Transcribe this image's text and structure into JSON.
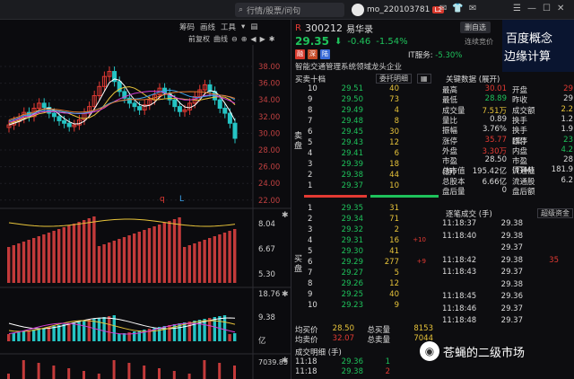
{
  "top": {
    "search_placeholder": "行情/股票/问句",
    "username": "mo_220103781",
    "level_badge": "L2"
  },
  "chart_toolbar": {
    "items": [
      "筹码",
      "画线",
      "工具"
    ],
    "items2": [
      "前复权",
      "曲线"
    ]
  },
  "chart": {
    "price_axis": [
      "38.00",
      "36.00",
      "34.00",
      "32.00",
      "30.00",
      "28.00",
      "26.00",
      "24.00",
      "22.00"
    ],
    "vol_axis": [
      "8.04",
      "6.67",
      "5.30"
    ],
    "macd_axis": [
      "18.76",
      "9.38",
      "亿"
    ],
    "bottom_axis": [
      "7039.85"
    ],
    "markers": [
      "q",
      "L"
    ]
  },
  "stock": {
    "prefix": "R",
    "code": "300212",
    "name": "易华录",
    "price": "29.35",
    "change": "-0.46",
    "change_pct": "-1.54%",
    "btn_delete": "删自选",
    "btn_auction": "连续竞价",
    "it_service_label": "IT服务:",
    "it_service_pct": "-5.30%",
    "tagline": "智能交通管理系统领域龙头企业",
    "flags": [
      "融",
      "深",
      "陆"
    ],
    "promo": [
      "百度概念",
      "边缘计算"
    ]
  },
  "orderbook": {
    "sell_title": "买卖十档",
    "delegate_btn": "委托明细",
    "sell_label": "卖盘",
    "buy_label": "买盘",
    "sells": [
      {
        "lvl": "10",
        "price": "29.51",
        "vol": "40",
        "extra": ""
      },
      {
        "lvl": "9",
        "price": "29.50",
        "vol": "73",
        "extra": ""
      },
      {
        "lvl": "8",
        "price": "29.49",
        "vol": "4",
        "extra": ""
      },
      {
        "lvl": "7",
        "price": "29.48",
        "vol": "8",
        "extra": ""
      },
      {
        "lvl": "6",
        "price": "29.45",
        "vol": "30",
        "extra": ""
      },
      {
        "lvl": "5",
        "price": "29.43",
        "vol": "12",
        "extra": ""
      },
      {
        "lvl": "4",
        "price": "29.41",
        "vol": "6",
        "extra": ""
      },
      {
        "lvl": "3",
        "price": "29.39",
        "vol": "18",
        "extra": ""
      },
      {
        "lvl": "2",
        "price": "29.38",
        "vol": "44",
        "extra": ""
      },
      {
        "lvl": "1",
        "price": "29.37",
        "vol": "10",
        "extra": ""
      }
    ],
    "buys": [
      {
        "lvl": "1",
        "price": "29.35",
        "vol": "31",
        "extra": ""
      },
      {
        "lvl": "2",
        "price": "29.34",
        "vol": "71",
        "extra": ""
      },
      {
        "lvl": "3",
        "price": "29.32",
        "vol": "2",
        "extra": ""
      },
      {
        "lvl": "4",
        "price": "29.31",
        "vol": "16",
        "extra": "+10"
      },
      {
        "lvl": "5",
        "price": "29.30",
        "vol": "41",
        "extra": ""
      },
      {
        "lvl": "6",
        "price": "29.29",
        "vol": "277",
        "extra": "+9"
      },
      {
        "lvl": "7",
        "price": "29.27",
        "vol": "5",
        "extra": ""
      },
      {
        "lvl": "8",
        "price": "29.26",
        "vol": "12",
        "extra": ""
      },
      {
        "lvl": "9",
        "price": "29.25",
        "vol": "40",
        "extra": ""
      },
      {
        "lvl": "10",
        "price": "29.23",
        "vol": "9",
        "extra": ""
      }
    ],
    "avg_buy_label": "均买价",
    "avg_buy": "28.50",
    "total_buy_label": "总买量",
    "total_buy": "8153",
    "avg_sell_label": "均卖价",
    "avg_sell": "32.07",
    "total_sell_label": "总卖量",
    "total_sell": "7044"
  },
  "stats": {
    "title": "关键数据 (展开)",
    "rows": [
      {
        "k": "最高",
        "v": "30.01",
        "vc": "red",
        "k2": "开盘",
        "v2": "29",
        "v2c": "red"
      },
      {
        "k": "最低",
        "v": "28.89",
        "vc": "green",
        "k2": "昨收",
        "v2": "29",
        "v2c": "white"
      },
      {
        "k": "成交量",
        "v": "7.51万",
        "vc": "yellow",
        "k2": "成交额",
        "v2": "2.2",
        "v2c": "yellow"
      },
      {
        "k": "量比",
        "v": "0.89",
        "vc": "white",
        "k2": "换手",
        "v2": "1.2",
        "v2c": "white"
      },
      {
        "k": "振幅",
        "v": "3.76%",
        "vc": "white",
        "k2": "换手(实)",
        "v2": "1.9",
        "v2c": "white"
      },
      {
        "k": "涨停",
        "v": "35.77",
        "vc": "red",
        "k2": "跌停",
        "v2": "23",
        "v2c": "green"
      },
      {
        "k": "外盘",
        "v": "3.30万",
        "vc": "red",
        "k2": "内盘",
        "v2": "4.2",
        "v2c": "green"
      },
      {
        "k": "市盈(静)",
        "v": "28.50",
        "vc": "white",
        "k2": "市盈(TTM)",
        "v2": "28",
        "v2c": "white"
      },
      {
        "k": "总市值",
        "v": "195.42亿",
        "vc": "white",
        "k2": "流通值",
        "v2": "181.9",
        "v2c": "white"
      },
      {
        "k": "总股本",
        "v": "6.66亿",
        "vc": "white",
        "k2": "流通股",
        "v2": "6.2",
        "v2c": "white"
      },
      {
        "k": "盘后量",
        "v": "0",
        "vc": "white",
        "k2": "盘后额",
        "v2": "",
        "v2c": "white"
      }
    ]
  },
  "trades": {
    "title": "逐笔成交 (手)",
    "btn": "超级资金",
    "rows": [
      {
        "t": "11:18:37",
        "p": "29.38",
        "pc": "white",
        "v": "",
        "vc": "white"
      },
      {
        "t": "11:18:40",
        "p": "29.38",
        "pc": "white",
        "v": "",
        "vc": "white"
      },
      {
        "t": "",
        "p": "29.37",
        "pc": "white",
        "v": "",
        "vc": "white"
      },
      {
        "t": "11:18:42",
        "p": "29.38",
        "pc": "white",
        "v": "35",
        "vc": "red"
      },
      {
        "t": "11:18:43",
        "p": "29.37",
        "pc": "white",
        "v": "",
        "vc": "white"
      },
      {
        "t": "",
        "p": "29.38",
        "pc": "white",
        "v": "",
        "vc": "white"
      },
      {
        "t": "11:18:45",
        "p": "29.36",
        "pc": "white",
        "v": "",
        "vc": "white"
      },
      {
        "t": "11:18:46",
        "p": "29.37",
        "pc": "white",
        "v": "",
        "vc": "white"
      },
      {
        "t": "11:18:48",
        "p": "29.37",
        "pc": "white",
        "v": "",
        "vc": "white"
      }
    ]
  },
  "deals": {
    "title": "成交明细 (手)",
    "rows": [
      {
        "t": "11:18",
        "p": "29.36",
        "v": "1"
      },
      {
        "t": "11:18",
        "p": "29.38",
        "v": "2"
      }
    ]
  },
  "watermark": "苍蝇的二级市场"
}
